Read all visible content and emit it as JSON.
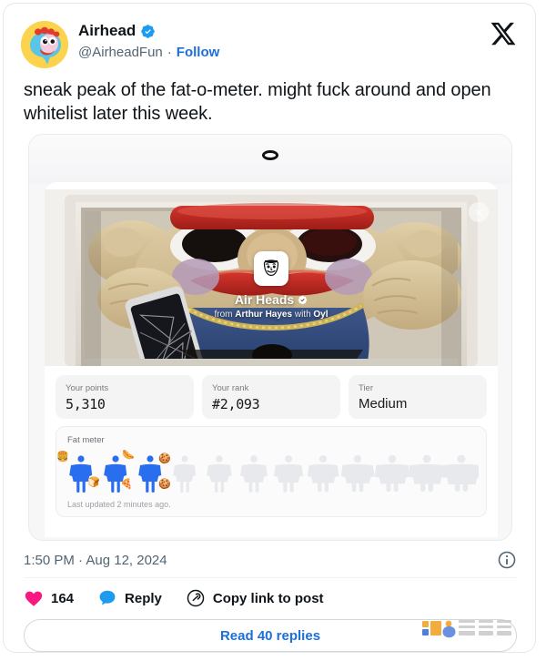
{
  "tweet": {
    "author_name": "Airhead",
    "author_handle": "@AirheadFun",
    "separator": "·",
    "follow_label": "Follow",
    "verified_icon": "verified-badge-icon",
    "avatar_icon": "airhead-avatar",
    "brand_icon": "x-logo-icon",
    "text": "sneak peak of the fat-o-meter. might fuck around and open whitelist later this week.",
    "timestamp": "1:50 PM · Aug 12, 2024",
    "info_icon": "info-circle-icon"
  },
  "embed": {
    "device_dot_icon": "camera-dot-icon",
    "close_icon": "close-icon",
    "collection": {
      "icon": "air-heads-logo-icon",
      "title": "Air Heads",
      "verified_icon": "verified-badge-icon",
      "subtitle_prefix": "from ",
      "subtitle_author": "Arthur Hayes",
      "subtitle_mid": " with ",
      "subtitle_collab": "Oyl"
    },
    "stats": [
      {
        "label": "Your points",
        "value": "5,310",
        "mono": true
      },
      {
        "label": "Your rank",
        "value": "#2,093",
        "mono": true
      },
      {
        "label": "Tier",
        "value": "Medium",
        "mono": false
      }
    ],
    "meter": {
      "label": "Fat meter",
      "updated": "Last updated 2 minutes ago.",
      "total": 12,
      "filled": 3,
      "filled_color": "#2a6ef0",
      "empty_color": "#e8e9ec",
      "emojis": [
        "🍔",
        "🍞",
        "🌭",
        "🍕",
        "🍪",
        "🥐"
      ]
    }
  },
  "actions": {
    "like": {
      "icon": "heart-icon",
      "count": "164",
      "color": "#f91880"
    },
    "reply": {
      "icon": "reply-icon",
      "label": "Reply",
      "color": "#1d9bf0"
    },
    "copy_link": {
      "icon": "link-icon",
      "label": "Copy link to post"
    }
  },
  "read_replies_label": "Read 40 replies",
  "watermark": {
    "name": "jinse-finance-watermark"
  },
  "colors": {
    "accent_blue": "#1d6fdb",
    "like_pink": "#f91880",
    "reply_blue": "#1d9bf0",
    "text_primary": "#0f1419",
    "text_secondary": "#536471"
  }
}
